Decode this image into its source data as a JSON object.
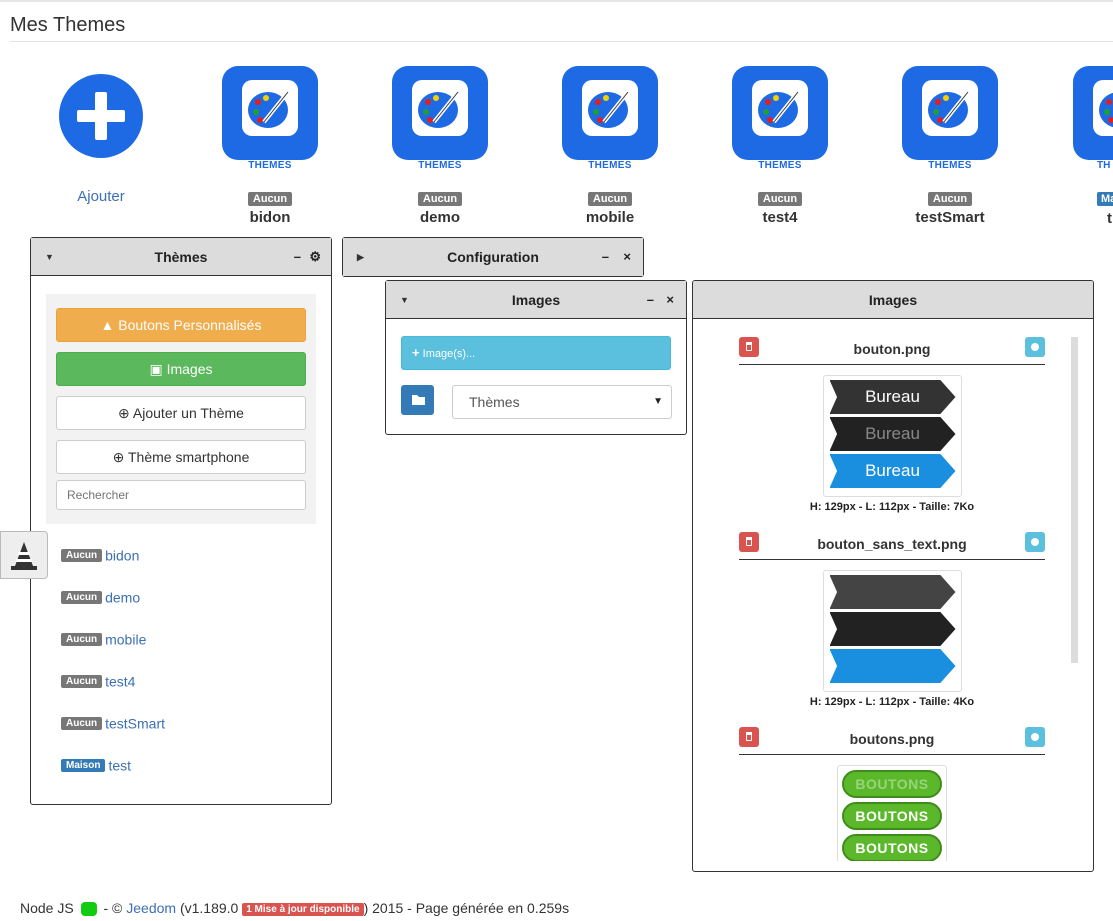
{
  "page": {
    "title": "Mes Themes"
  },
  "add_tile": {
    "label": "Ajouter"
  },
  "tiles": [
    {
      "icon_label": "THEMES",
      "badge": "Aucun",
      "name": "bidon"
    },
    {
      "icon_label": "THEMES",
      "badge": "Aucun",
      "name": "demo"
    },
    {
      "icon_label": "THEMES",
      "badge": "Aucun",
      "name": "mobile"
    },
    {
      "icon_label": "THEMES",
      "badge": "Aucun",
      "name": "test4"
    },
    {
      "icon_label": "THEMES",
      "badge": "Aucun",
      "name": "testSmart"
    },
    {
      "icon_label": "TH",
      "badge": "Ma",
      "name": "t"
    }
  ],
  "themes_panel": {
    "title": "Thèmes",
    "minimize": "–",
    "settings_icon": "gears-icon",
    "buttons": {
      "custom": "Boutons Personnalisés",
      "images": "Images",
      "add_theme": "Ajouter un Thème",
      "smartphone": "Thème smartphone"
    },
    "search_placeholder": "Rechercher",
    "list": [
      {
        "badge": "Aucun",
        "name": "bidon"
      },
      {
        "badge": "Aucun",
        "name": "demo"
      },
      {
        "badge": "Aucun",
        "name": "mobile"
      },
      {
        "badge": "Aucun",
        "name": "test4"
      },
      {
        "badge": "Aucun",
        "name": "testSmart"
      },
      {
        "badge": "Maison",
        "name": "test"
      }
    ]
  },
  "config_panel": {
    "title": "Configuration",
    "minimize": "–",
    "close": "×"
  },
  "images_panel": {
    "title": "Images",
    "minimize": "–",
    "close": "×",
    "add_button": "Image(s)...",
    "select_value": "Thèmes"
  },
  "gallery_panel": {
    "title": "Images",
    "items": [
      {
        "filename": "bouton.png",
        "caption": "H: 129px - L: 112px - Taille: 7Ko",
        "labels": [
          "Bureau",
          "Bureau",
          "Bureau"
        ]
      },
      {
        "filename": "bouton_sans_text.png",
        "caption": "H: 129px - L: 112px - Taille: 4Ko"
      },
      {
        "filename": "boutons.png",
        "labels": [
          "BOUTONS",
          "BOUTONS",
          "BOUTONS"
        ]
      }
    ]
  },
  "footer": {
    "node": "Node JS",
    "copyright": "- ©",
    "brand": "Jeedom",
    "version_open": "(v1.189.0",
    "update_badge": "1 Mise à jour disponible",
    "rest": ") 2015 - Page générée en 0.259s"
  },
  "colors": {
    "tile_blue": "#1d6ae4",
    "btn_orange": "#f0ad4e",
    "btn_green": "#5cb85c",
    "btn_info": "#5bc0de",
    "btn_danger": "#d9534f",
    "badge_grey": "#777777",
    "badge_blue": "#337ab7"
  }
}
